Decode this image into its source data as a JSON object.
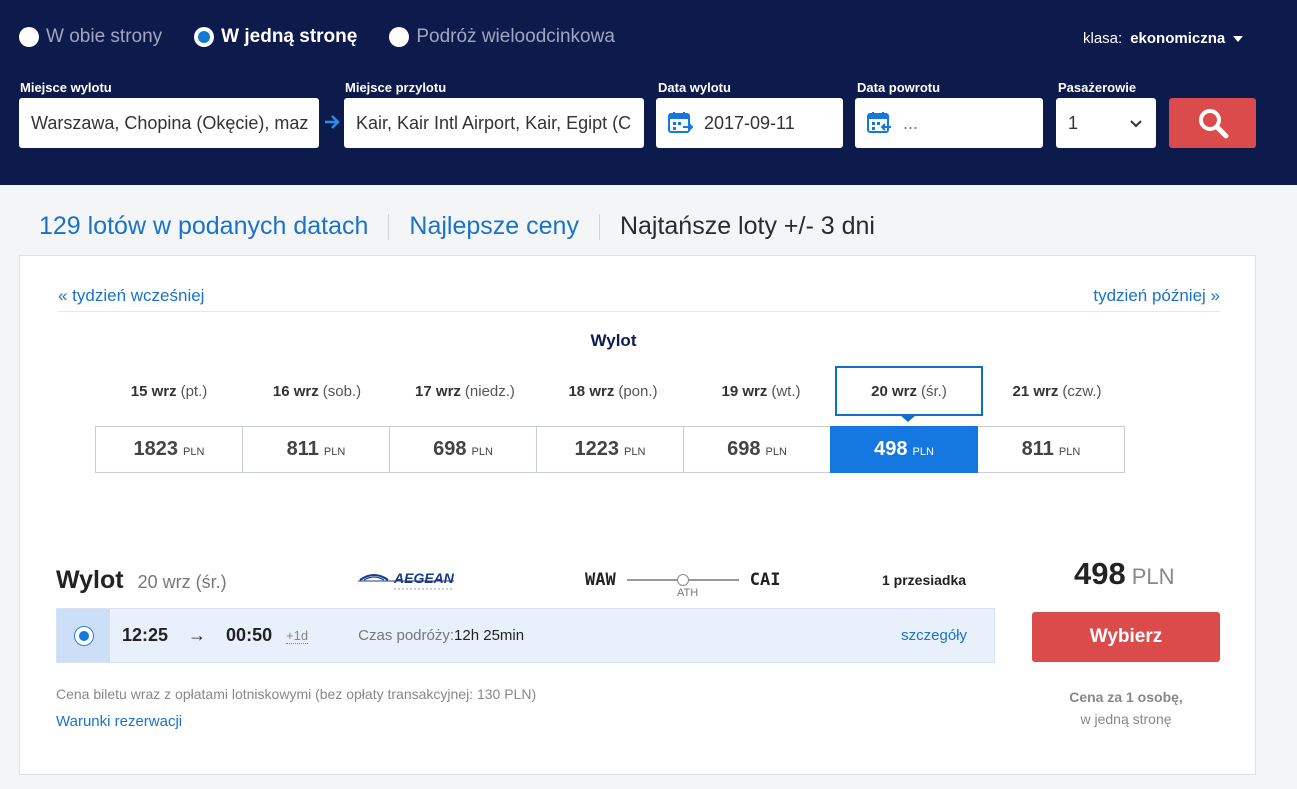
{
  "trip_type": {
    "options": [
      {
        "label": "W obie strony",
        "selected": false
      },
      {
        "label": "W jedną stronę",
        "selected": true
      },
      {
        "label": "Podróż wieloodcinkowa",
        "selected": false
      }
    ]
  },
  "cabin": {
    "label": "klasa:",
    "value": "ekonomiczna"
  },
  "search": {
    "from_label": "Miejsce wylotu",
    "from_value": "Warszawa, Chopina (Okęcie), maz",
    "to_label": "Miejsce przylotu",
    "to_value": "Kair, Kair Intl Airport, Kair, Egipt (C",
    "depart_label": "Data wylotu",
    "depart_value": "2017-09-11",
    "return_label": "Data powrotu",
    "return_value": "...",
    "pax_label": "Pasażerowie",
    "pax_value": "1"
  },
  "tabs": [
    {
      "label": "129 lotów w podanych datach",
      "active": false
    },
    {
      "label": "Najlepsze ceny",
      "active": false
    },
    {
      "label": "Najtańsze loty +/- 3 dni",
      "active": true
    }
  ],
  "calendar": {
    "prev_week": "« tydzień wcześniej",
    "next_week": "tydzień później »",
    "heading": "Wylot",
    "days": [
      {
        "day": "15 wrz",
        "weekday": "(pt.)",
        "price": "1823",
        "currency": "PLN",
        "selected": false
      },
      {
        "day": "16 wrz",
        "weekday": "(sob.)",
        "price": "811",
        "currency": "PLN",
        "selected": false
      },
      {
        "day": "17 wrz",
        "weekday": "(niedz.)",
        "price": "698",
        "currency": "PLN",
        "selected": false
      },
      {
        "day": "18 wrz",
        "weekday": "(pon.)",
        "price": "1223",
        "currency": "PLN",
        "selected": false
      },
      {
        "day": "19 wrz",
        "weekday": "(wt.)",
        "price": "698",
        "currency": "PLN",
        "selected": false
      },
      {
        "day": "20 wrz",
        "weekday": "(śr.)",
        "price": "498",
        "currency": "PLN",
        "selected": true
      },
      {
        "day": "21 wrz",
        "weekday": "(czw.)",
        "price": "811",
        "currency": "PLN",
        "selected": false
      }
    ]
  },
  "flight": {
    "title": "Wylot",
    "date": "20 wrz (śr.)",
    "airline": "AEGEAN",
    "origin": "WAW",
    "destination": "CAI",
    "via": "ATH",
    "stops": "1 przesiadka",
    "price": "498",
    "currency": "PLN",
    "depart_time": "12:25",
    "arrow": "→",
    "arrive_time": "00:50",
    "day_offset": "+1d",
    "duration_label": "Czas podróży:",
    "duration_value": "12h 25min",
    "details_link": "szczegóły",
    "select_button": "Wybierz",
    "price_note": "Cena biletu wraz z opłatami lotniskowymi (bez opłaty transakcyjnej: 130 PLN)",
    "terms_link": "Warunki rezerwacji",
    "per_person_line1": "Cena za 1 osobę,",
    "per_person_line2": "w jedną stronę"
  },
  "colors": {
    "header_bg": "#0d1b4c",
    "accent_blue": "#1478e0",
    "cta_red": "#db4b4b",
    "link_blue": "#1a73c9"
  }
}
